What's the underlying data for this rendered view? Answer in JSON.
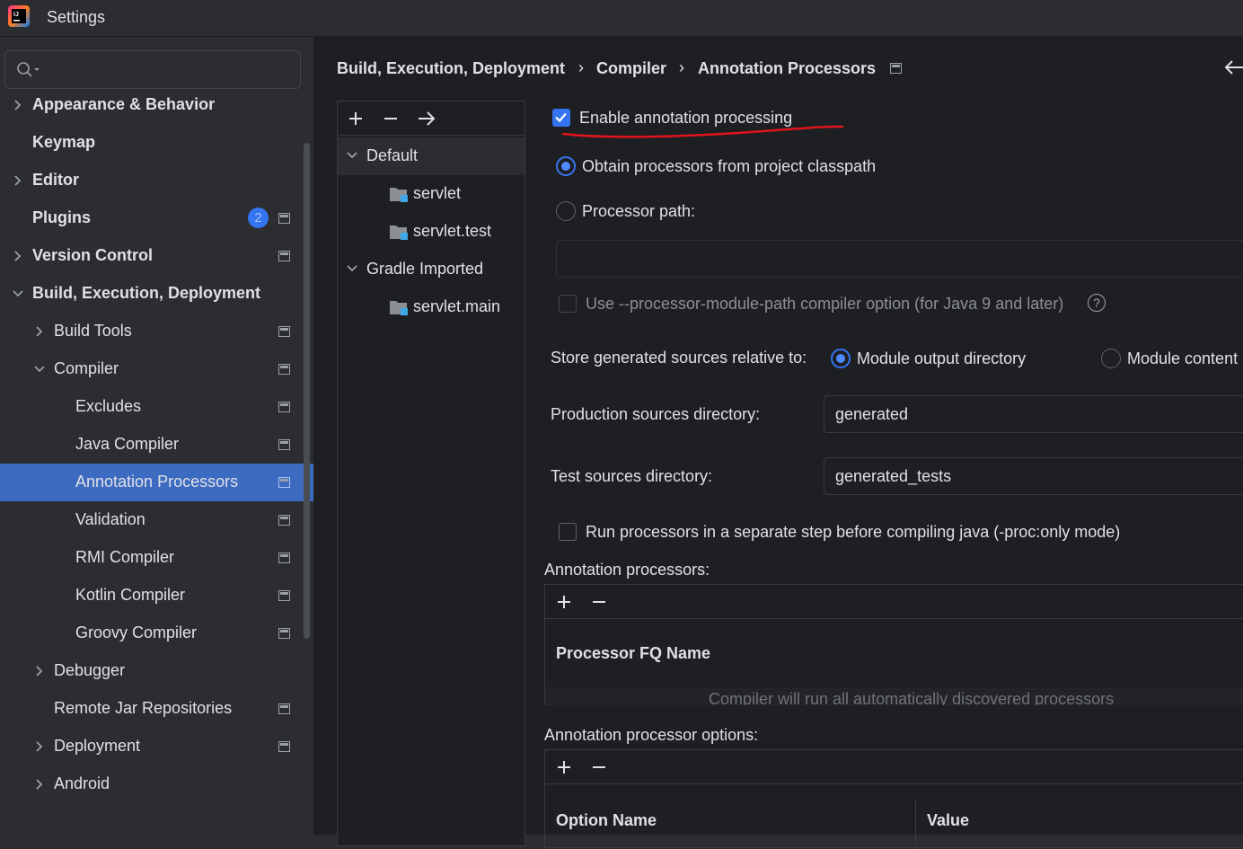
{
  "window": {
    "title": "Settings"
  },
  "search": {
    "placeholder": ""
  },
  "sidebar": {
    "items": [
      {
        "label": "Appearance & Behavior",
        "bold": true
      },
      {
        "label": "Keymap",
        "bold": true
      },
      {
        "label": "Editor",
        "bold": true
      },
      {
        "label": "Plugins",
        "bold": true,
        "badge": "2"
      },
      {
        "label": "Version Control",
        "bold": true
      },
      {
        "label": "Build, Execution, Deployment",
        "bold": true
      },
      {
        "label": "Build Tools"
      },
      {
        "label": "Compiler"
      },
      {
        "label": "Excludes"
      },
      {
        "label": "Java Compiler"
      },
      {
        "label": "Annotation Processors",
        "selected": true
      },
      {
        "label": "Validation"
      },
      {
        "label": "RMI Compiler"
      },
      {
        "label": "Kotlin Compiler"
      },
      {
        "label": "Groovy Compiler"
      },
      {
        "label": "Debugger"
      },
      {
        "label": "Remote Jar Repositories"
      },
      {
        "label": "Deployment"
      },
      {
        "label": "Android"
      }
    ]
  },
  "breadcrumb": [
    "Build, Execution, Deployment",
    "Compiler",
    "Annotation Processors"
  ],
  "modules": {
    "items": [
      {
        "label": "Default",
        "group": true,
        "selected": true
      },
      {
        "label": "servlet"
      },
      {
        "label": "servlet.test"
      },
      {
        "label": "Gradle Imported",
        "group": true
      },
      {
        "label": "servlet.main"
      }
    ]
  },
  "form": {
    "enable_annotation_processing": {
      "label": "Enable annotation processing",
      "checked": true
    },
    "obtain_from_classpath": {
      "label": "Obtain processors from project classpath",
      "selected": true
    },
    "processor_path": {
      "label": "Processor path:",
      "value": ""
    },
    "use_module_path": {
      "label": "Use --processor-module-path compiler option (for Java 9 and later)",
      "checked": false
    },
    "store_generated": {
      "label": "Store generated sources relative to:",
      "option_output": "Module output directory",
      "option_content": "Module content",
      "selected": "Module output directory"
    },
    "production_dir": {
      "label": "Production sources directory:",
      "value": "generated"
    },
    "test_dir": {
      "label": "Test sources directory:",
      "value": "generated_tests"
    },
    "run_separate": {
      "label": "Run processors in a separate step before compiling java (-proc:only mode)",
      "checked": false
    },
    "processors_section": {
      "label": "Annotation processors:",
      "column": "Processor FQ Name",
      "empty_text": "Compiler will run all automatically discovered processors"
    },
    "options_section": {
      "label": "Annotation processor options:",
      "columns": [
        "Option Name",
        "Value"
      ]
    }
  },
  "colors": {
    "accent": "#3574f0",
    "selection": "#3d6bc1",
    "annotation_stroke": "#e0141e"
  }
}
